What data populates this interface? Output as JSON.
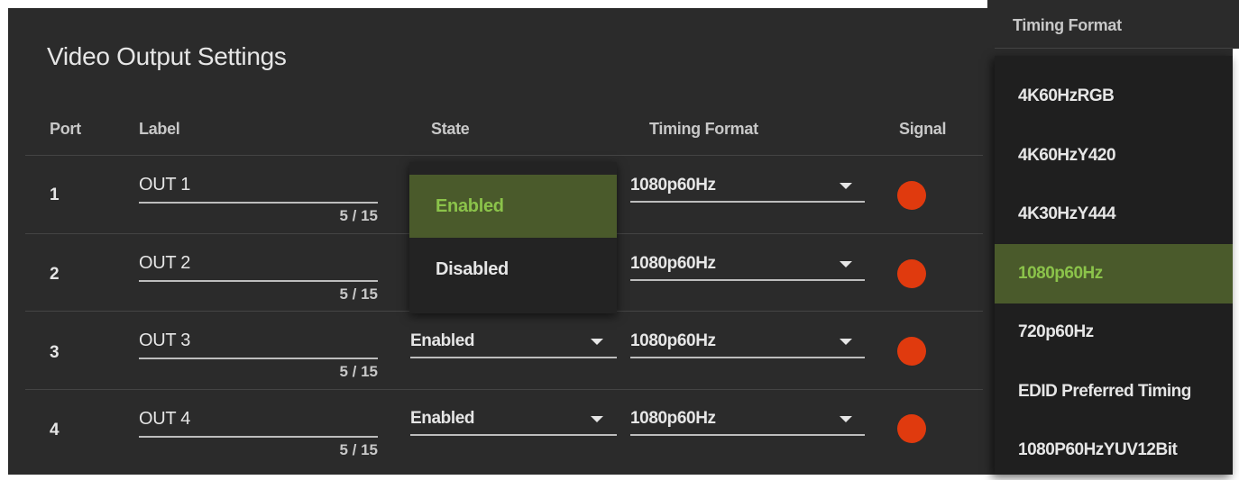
{
  "title": "Video Output Settings",
  "columns": {
    "port": "Port",
    "label": "Label",
    "state": "State",
    "timing": "Timing Format",
    "signal": "Signal"
  },
  "rows": [
    {
      "port": "1",
      "label": "OUT 1",
      "counter": "5 / 15",
      "state": "",
      "timing": "1080p60Hz",
      "signal_color": "#e03a0e"
    },
    {
      "port": "2",
      "label": "OUT 2",
      "counter": "5 / 15",
      "state": "",
      "timing": "1080p60Hz",
      "signal_color": "#e03a0e"
    },
    {
      "port": "3",
      "label": "OUT 3",
      "counter": "5 / 15",
      "state": "Enabled",
      "timing": "1080p60Hz",
      "signal_color": "#e03a0e"
    },
    {
      "port": "4",
      "label": "OUT 4",
      "counter": "5 / 15",
      "state": "Enabled",
      "timing": "1080p60Hz",
      "signal_color": "#e03a0e"
    }
  ],
  "state_menu": {
    "options": [
      "Enabled",
      "Disabled"
    ],
    "selected": "Enabled"
  },
  "timing_menu": {
    "header": "Timing Format",
    "options": [
      "4K60HzRGB",
      "4K60HzY420",
      "4K30HzY444",
      "1080p60Hz",
      "720p60Hz",
      "EDID Preferred Timing",
      "1080P60HzYUV12Bit"
    ],
    "selected": "1080p60Hz"
  },
  "colors": {
    "panel": "#2b2b2b",
    "accent": "#8bc34a",
    "selected_bg": "#4a5a2b",
    "signal": "#e03a0e"
  }
}
